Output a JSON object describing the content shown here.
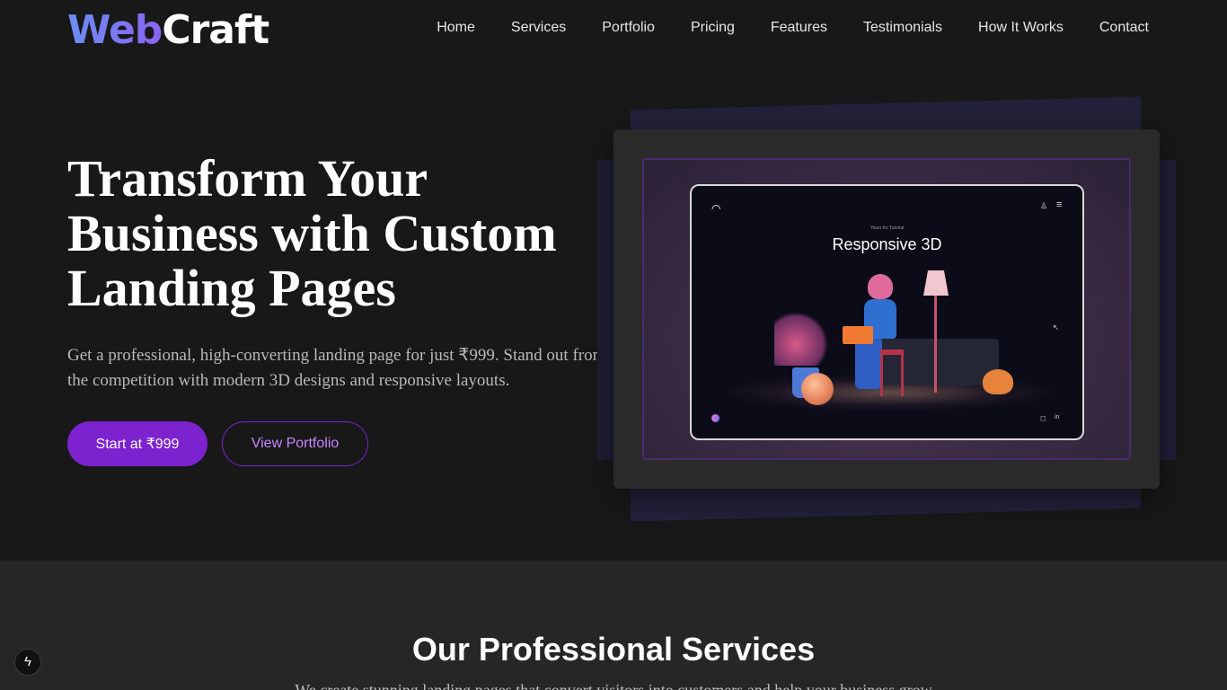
{
  "header": {
    "logo_web": "Web",
    "logo_craft": "Craft",
    "nav": [
      "Home",
      "Services",
      "Portfolio",
      "Pricing",
      "Features",
      "Testimonials",
      "How It Works",
      "Contact"
    ]
  },
  "hero": {
    "title": "Transform Your Business with Custom Landing Pages",
    "subtitle": "Get a professional, high-converting landing page for just ₹999. Stand out from the competition with modern 3D designs and responsive layouts.",
    "primary_button": "Start at ₹999",
    "secondary_button": "View Portfolio"
  },
  "showcase": {
    "kicker": "Yours for Tutorial",
    "title": "Responsive 3D",
    "social_right": "in"
  },
  "services": {
    "title": "Our Professional Services",
    "subtitle": "We create stunning landing pages that convert visitors into customers and help your business grow"
  },
  "icons": {
    "fab": "bolt-icon"
  },
  "colors": {
    "accent": "#7d22cf",
    "accent_text": "#c987ff",
    "logo_gradient_start": "#6b8ef5",
    "logo_gradient_end": "#8b63f0"
  }
}
